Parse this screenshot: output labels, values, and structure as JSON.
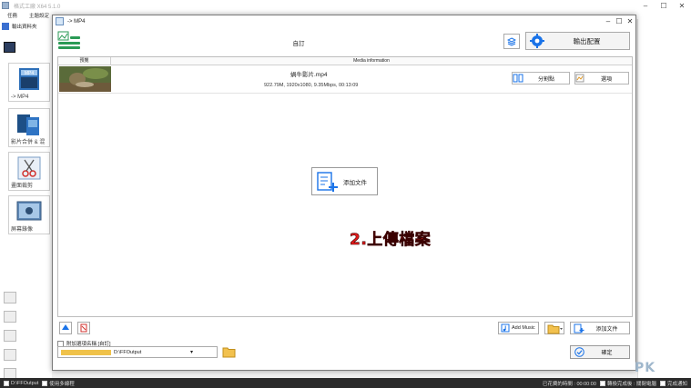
{
  "app": {
    "title": "格式工廠 X64 5.1.0",
    "menu": [
      "任務",
      "主題設定",
      "語言",
      "幫助",
      "說明"
    ],
    "favorites_label": "輸出資料夾",
    "tools": [
      {
        "label": "-> MP4",
        "icon": "mp4-film-icon"
      },
      {
        "label": "影片合併 & 混",
        "icon": "video-merge-icon"
      },
      {
        "label": "畫面裁剪",
        "icon": "scissors-icon"
      },
      {
        "label": "屏幕錄像",
        "icon": "screen-record-icon"
      }
    ],
    "status_left": "D:\\FFOutput",
    "status_check": "使用多線程",
    "status_time_label": "已花費的時間 : 00:00:00",
    "status_after": "轉換完成後 : 關閉電腦",
    "status_notify": "完成通知",
    "watermark": "PK"
  },
  "dialog": {
    "title": "-> MP4",
    "subtitle": "自訂",
    "output_settings_label": "輸出配置",
    "columns": [
      "預覽",
      "Media information"
    ],
    "files": [
      {
        "name": "蝸牛影片.mp4",
        "meta": "922.79M, 1920x1080, 9.35Mbps, 00:13:09",
        "split_label": "分割點",
        "options_label": "選項"
      }
    ],
    "add_file_center_label": "添加文件",
    "add_music_label": "Add Music",
    "add_file_label": "添加文件",
    "suffix_label": "附加選項名稱 [自訂]",
    "output_path": "D:\\FFOutput",
    "ok_label": "確定"
  },
  "overlay_text": "2.上傳檔案",
  "colors": {
    "accent": "#1a73e8",
    "overlay": "#e21b1b",
    "status_bg": "#2b2b2b"
  }
}
